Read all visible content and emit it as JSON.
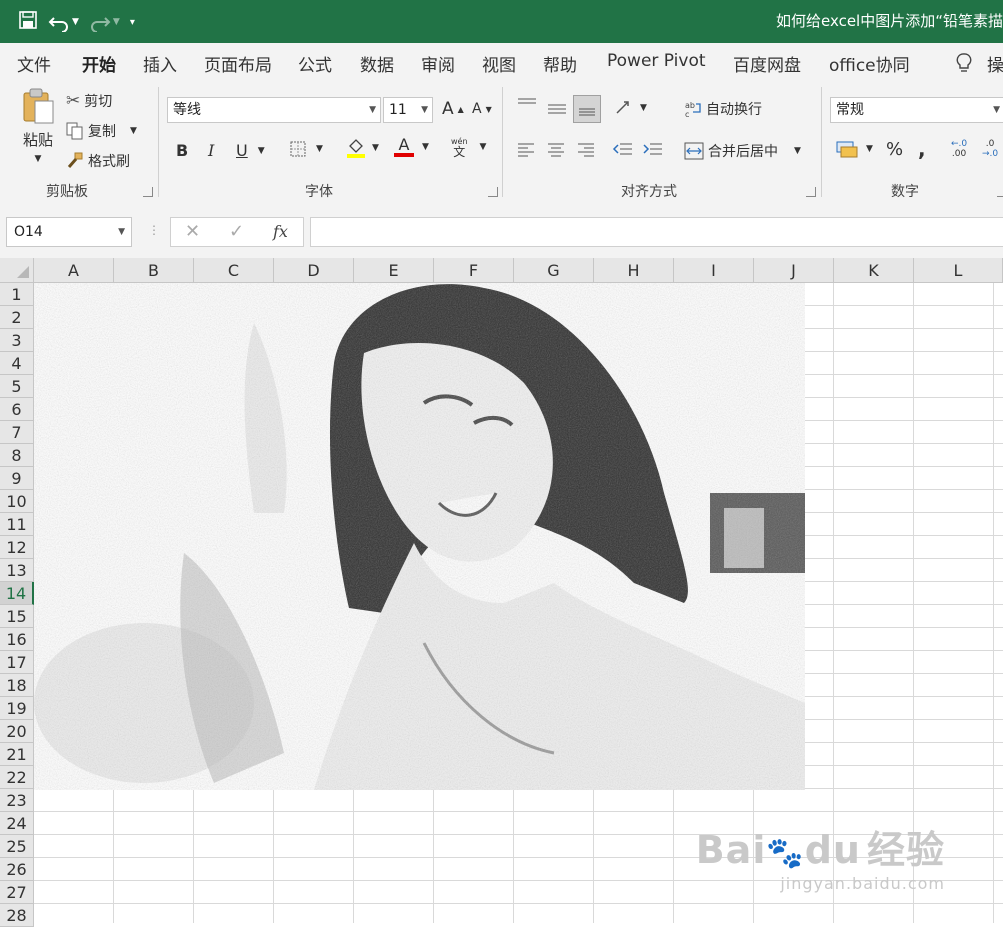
{
  "title_bar": {
    "document_title": "如何给excel中图片添加“铅笔素描",
    "accent_color": "#217346",
    "qat": {
      "save_icon": "save-icon",
      "undo_icon": "undo-icon",
      "redo_icon": "redo-icon",
      "customize_icon": "customize-qat-icon"
    }
  },
  "tabs": [
    "文件",
    "开始",
    "插入",
    "页面布局",
    "公式",
    "数据",
    "审阅",
    "视图",
    "帮助",
    "Power Pivot",
    "百度网盘",
    "office协同"
  ],
  "active_tab": "开始",
  "tell_me": "操",
  "clipboard": {
    "paste": "粘贴",
    "cut": "剪切",
    "copy": "复制",
    "format_painter": "格式刷",
    "group": "剪贴板"
  },
  "font": {
    "name": "等线",
    "size": "11",
    "bold": "B",
    "italic": "I",
    "underline": "U",
    "font_color_letter": "A",
    "phonetic_top": "wén",
    "phonetic_bottom": "文",
    "grow": "A",
    "shrink": "A",
    "group": "字体"
  },
  "alignment": {
    "wrap_text": "自动换行",
    "merge_center": "合并后居中",
    "group": "对齐方式"
  },
  "number": {
    "format": "常规",
    "percent": "%",
    "comma": ",",
    "inc_decimal": ".00",
    "dec_decimal": ".0",
    "group": "数字"
  },
  "formula_bar": {
    "name_box": "O14",
    "fx": "fx",
    "content": ""
  },
  "columns": [
    "A",
    "B",
    "C",
    "D",
    "E",
    "F",
    "G",
    "H",
    "I",
    "J",
    "K",
    "L"
  ],
  "rows": [
    "1",
    "2",
    "3",
    "4",
    "5",
    "6",
    "7",
    "8",
    "9",
    "10",
    "11",
    "12",
    "13",
    "14",
    "15",
    "16",
    "17",
    "18",
    "19",
    "20",
    "21",
    "22",
    "23",
    "24",
    "25",
    "26",
    "27",
    "28"
  ],
  "selected_row": "14",
  "watermark": {
    "brand": "Bai",
    "brand2": "du",
    "suffix": "经验",
    "url": "jingyan.baidu.com"
  }
}
